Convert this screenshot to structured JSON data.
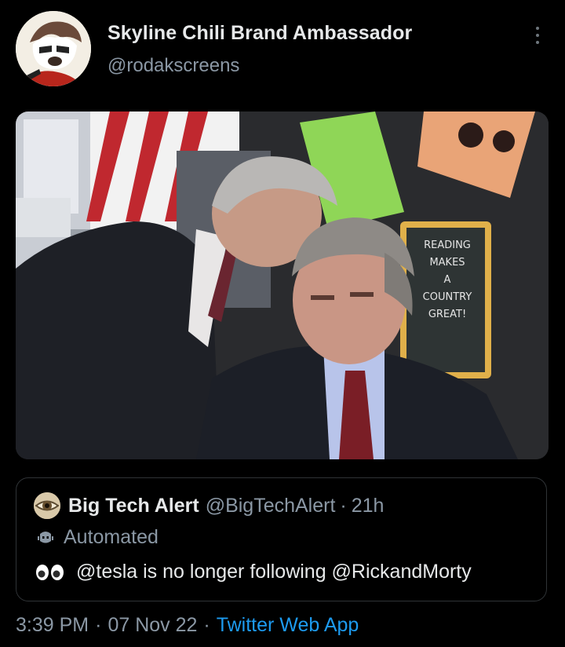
{
  "tweet": {
    "display_name": "Skyline Chili Brand Ambassador",
    "handle": "@rodakscreens",
    "media": {
      "chalkboard_lines": [
        "READING",
        "MAKES",
        "A",
        "COUNTRY",
        "GREAT!"
      ]
    },
    "quote": {
      "name": "Big Tech Alert",
      "handle": "@BigTechAlert",
      "separator": "·",
      "time": "21h",
      "label": "Automated",
      "text": "@tesla is no longer following @RickandMorty"
    },
    "footer": {
      "time": "3:39 PM",
      "separator": "·",
      "date": "07 Nov 22",
      "source": "Twitter Web App"
    }
  },
  "colors": {
    "background": "#000000",
    "text_primary": "#e7e9ea",
    "text_secondary": "#8b98a5",
    "link": "#1d9bf0",
    "border": "#2f3336"
  },
  "icons": {
    "more": "more-icon",
    "bot": "bot-icon",
    "eyes": "eyes-emoji-icon"
  }
}
